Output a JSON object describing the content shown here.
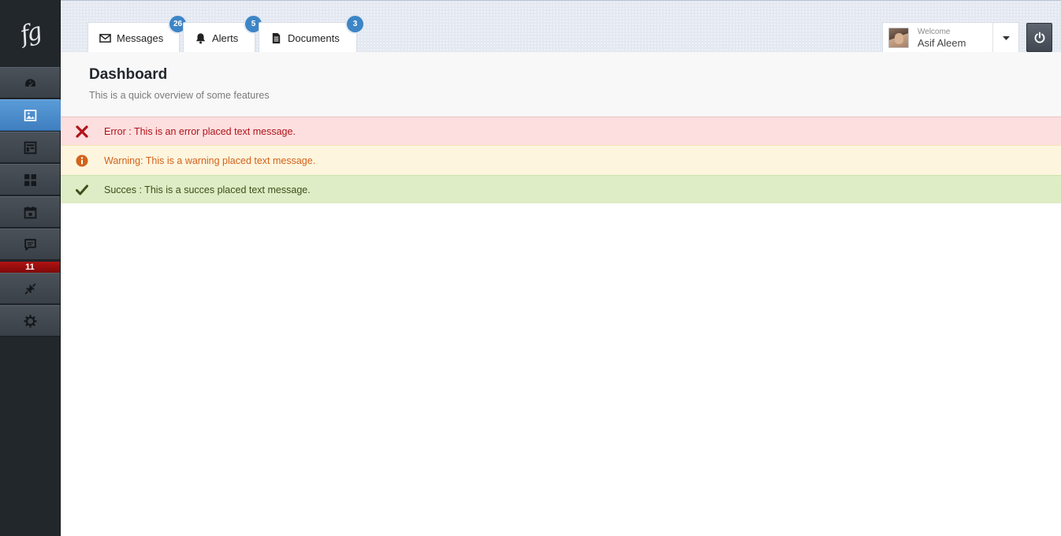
{
  "app": {
    "logo_text": "fg"
  },
  "sidebar": {
    "items": [
      {
        "icon": "dashboard-gauge-icon",
        "active": false
      },
      {
        "icon": "image-gallery-icon",
        "active": true
      },
      {
        "icon": "layout-icon",
        "active": false
      },
      {
        "icon": "grid-icon",
        "active": false
      },
      {
        "icon": "calendar-icon",
        "active": false
      },
      {
        "icon": "chat-icon",
        "active": false
      },
      {
        "icon": "plug-icon",
        "active": false
      },
      {
        "icon": "gear-icon",
        "active": false
      }
    ],
    "chat_badge": "11"
  },
  "topbar": {
    "tabs": [
      {
        "label": "Messages",
        "icon": "envelope-icon",
        "count": "26"
      },
      {
        "label": "Alerts",
        "icon": "bell-icon",
        "count": "5"
      },
      {
        "label": "Documents",
        "icon": "document-icon",
        "count": "3"
      }
    ],
    "user": {
      "welcome": "Welcome",
      "name": "Asif Aleem"
    },
    "power_icon": "power-icon"
  },
  "page": {
    "title": "Dashboard",
    "subtitle": "This is a quick overview of some features"
  },
  "alerts": {
    "error": {
      "text": "Error : This is an error placed text message.",
      "color": "#b1131a"
    },
    "warning": {
      "text": "Warning: This is a warning placed text message.",
      "color": "#d2631b"
    },
    "success": {
      "text": "Succes : This is a succes placed text message.",
      "color": "#3f4f1a"
    }
  },
  "colors": {
    "accent": "#4b8dcc",
    "sidebar": "#22272c",
    "badge": "#3d85c6"
  }
}
